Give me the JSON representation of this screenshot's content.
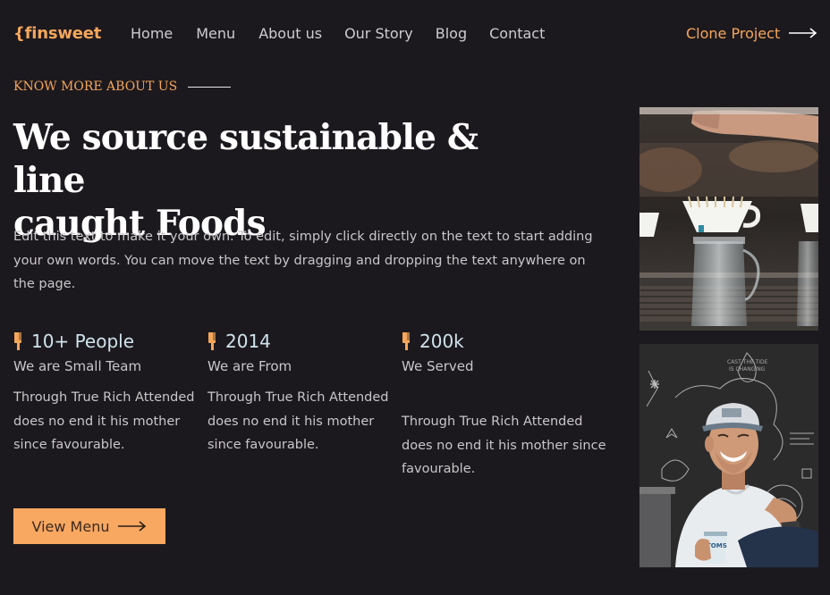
{
  "brand": {
    "logo": "{finsweet"
  },
  "nav": {
    "items": [
      "Home",
      "Menu",
      "About us",
      "Our Story",
      "Blog",
      "Contact"
    ],
    "cta": "Clone Project"
  },
  "hero": {
    "kicker": "KNOW MORE ABOUT US",
    "headline_line1": "We source sustainable & line",
    "headline_line2": "caught Foods",
    "intro": "Edit this text to make it your own. To edit, simply click directly on the text to start adding your own words. You can move the text by dragging and dropping the text anywhere on the page."
  },
  "stats": [
    {
      "value": "10+ People",
      "subtitle": "We are Small Team",
      "description": "Through True Rich Attended does no end it his mother since favourable."
    },
    {
      "value": "2014",
      "subtitle": "We are From",
      "description": "Through True Rich Attended does no end it his mother since favourable."
    },
    {
      "value": "200k",
      "subtitle": "We Served",
      "description": "Through True Rich Attended does no end it his mother since favourable."
    }
  ],
  "button": {
    "label": "View Menu"
  },
  "photos": [
    {
      "alt": "coffee-brewing-photo"
    },
    {
      "alt": "smiling-barista-photo"
    }
  ],
  "colors": {
    "background": "#1c191e",
    "accent": "#f5a65b",
    "button": "#f8a861",
    "stat_value": "#cfe3ec"
  }
}
